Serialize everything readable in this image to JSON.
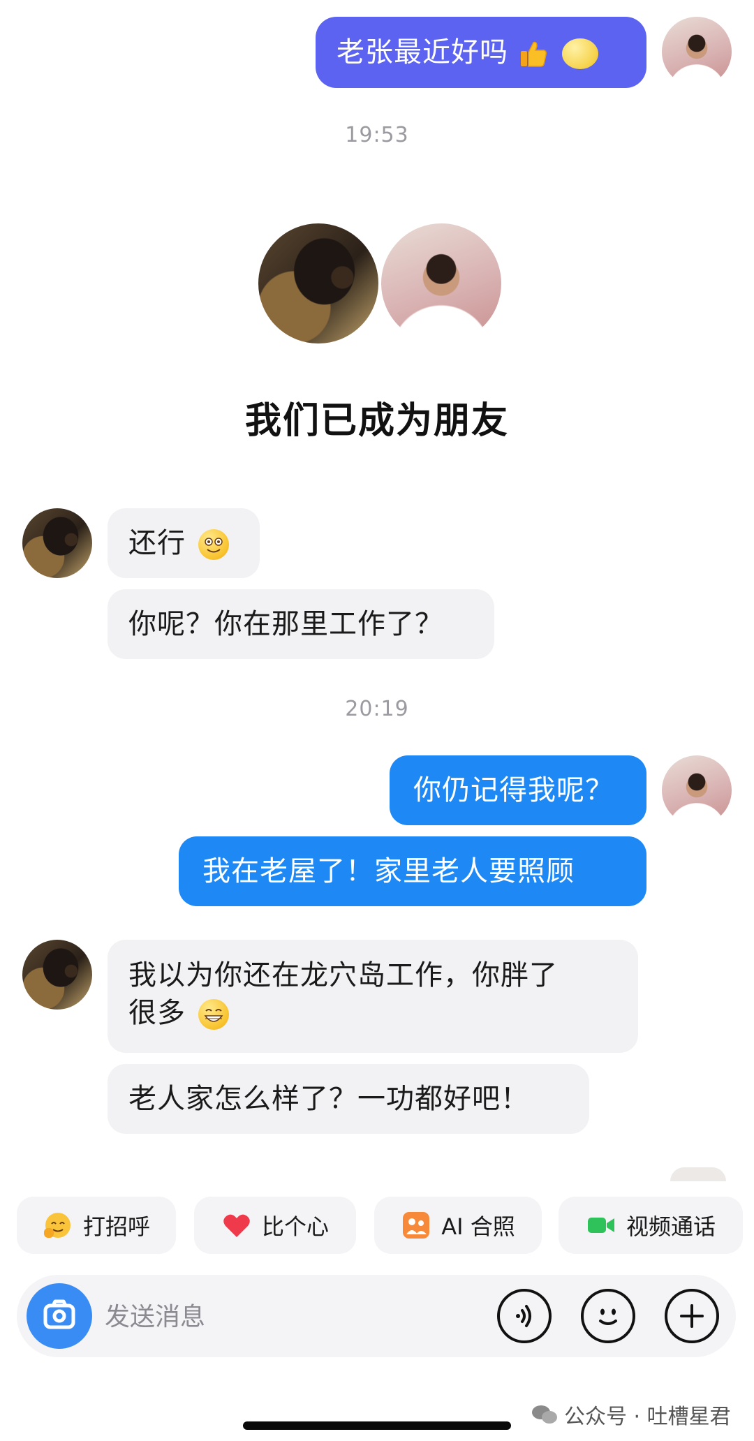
{
  "messages": [
    {
      "text": "老张最近好吗",
      "emoji": [
        "thumbs-up-emoji",
        "thinking-face-emoji"
      ]
    },
    {
      "time": "19:53"
    },
    {
      "banner": "我们已成为朋友"
    },
    {
      "text": "还行",
      "emoji": "smiling-face-emoji"
    },
    {
      "text": "你呢？你在那里工作了？"
    },
    {
      "time": "20:19"
    },
    {
      "text": "你仍记得我呢？"
    },
    {
      "text": "我在老屋了！家里老人要照顾"
    },
    {
      "text_line1": "我以为你还在龙穴岛工作，你胖了",
      "text_line2": "很多",
      "emoji": "grinning-face-emoji"
    },
    {
      "text": "老人家怎么样了？一功都好吧！"
    }
  ],
  "quick_actions": [
    {
      "label": "打招呼",
      "icon": "wave-emoji-icon"
    },
    {
      "label": "比个心",
      "icon": "heart-icon"
    },
    {
      "label": "AI 合照",
      "icon": "ai-photo-icon"
    },
    {
      "label": "视频通话",
      "icon": "video-call-icon"
    }
  ],
  "input": {
    "placeholder": "发送消息"
  },
  "icons": {
    "camera": "camera-icon",
    "voice": "voice-icon",
    "emoji": "emoji-face-icon",
    "plus": "plus-icon"
  },
  "watermark": {
    "text": "公众号 · 吐槽星君"
  },
  "colors": {
    "purple_bubble": "#5b63f0",
    "blue_bubble": "#1e88f4",
    "gray_bubble": "#f2f2f4",
    "camera_button": "#3a8cf5"
  }
}
